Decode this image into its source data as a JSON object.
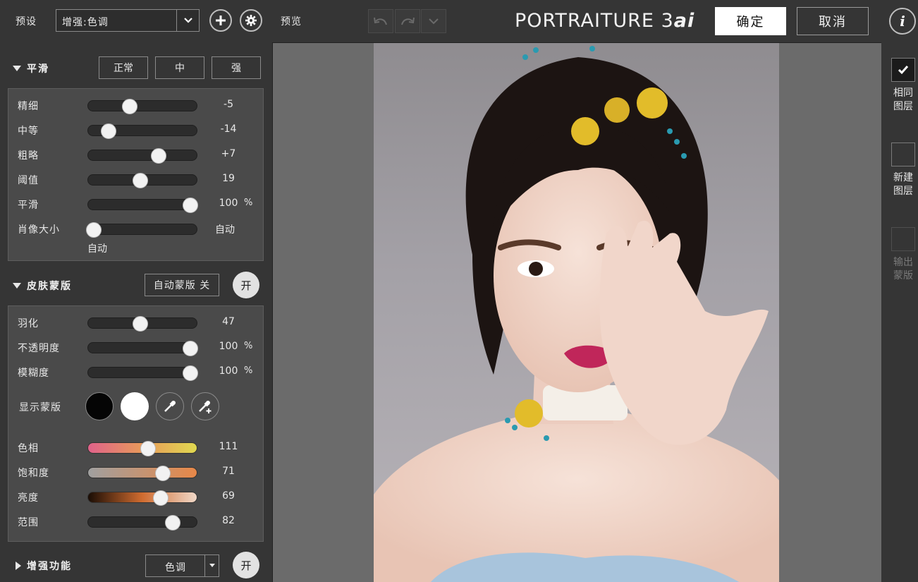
{
  "topbar": {
    "preset_label": "预设",
    "preset_value": "增强:色调",
    "preview_label": "预览",
    "logo_main": "PORTRAITURE 3",
    "logo_ai": "ai",
    "ok_label": "确定",
    "cancel_label": "取消",
    "info_label": "i"
  },
  "smooth": {
    "title": "平滑",
    "modes": [
      "正常",
      "中",
      "强"
    ],
    "sliders": [
      {
        "name": "精细",
        "value": "-5",
        "unit": "",
        "pos": 0.38
      },
      {
        "name": "中等",
        "value": "-14",
        "unit": "",
        "pos": 0.19
      },
      {
        "name": "粗略",
        "value": "+7",
        "unit": "",
        "pos": 0.65
      },
      {
        "name": "阈值",
        "value": "19",
        "unit": "",
        "pos": 0.48
      },
      {
        "name": "平滑",
        "value": "100",
        "unit": "%",
        "pos": 0.94
      }
    ],
    "portrait_size_label": "肖像大小",
    "portrait_size_value": "自动",
    "portrait_size_sub": "自动",
    "portrait_size_pos": 0.05
  },
  "skin_mask": {
    "title": "皮肤蒙版",
    "auto_mask_label": "自动蒙版 关",
    "on_label": "开",
    "sliders": [
      {
        "name": "羽化",
        "value": "47",
        "unit": "",
        "pos": 0.48
      },
      {
        "name": "不透明度",
        "value": "100",
        "unit": "%",
        "pos": 0.94
      },
      {
        "name": "模糊度",
        "value": "100",
        "unit": "%",
        "pos": 0.94
      }
    ],
    "show_mask_label": "显示蒙版",
    "color_sliders": [
      {
        "name": "色相",
        "value": "111",
        "pos": 0.55
      },
      {
        "name": "饱和度",
        "value": "71",
        "pos": 0.69
      },
      {
        "name": "亮度",
        "value": "69",
        "pos": 0.67
      },
      {
        "name": "范围",
        "value": "82",
        "pos": 0.78
      }
    ]
  },
  "enhance": {
    "title": "增强功能",
    "select_value": "色调",
    "on_label": "开"
  },
  "right_panel": {
    "same_layer": "相同图层",
    "new_layer": "新建图层",
    "output_mask": "输出蒙版"
  },
  "colors": {
    "hue_gradient": "#e0628a,#e89a5a,#e0d850",
    "sat_gradient": "#a0a0a0,#e88848",
    "lum_gradient": "#1a0d05,#d06c30,#f0d8c8"
  }
}
